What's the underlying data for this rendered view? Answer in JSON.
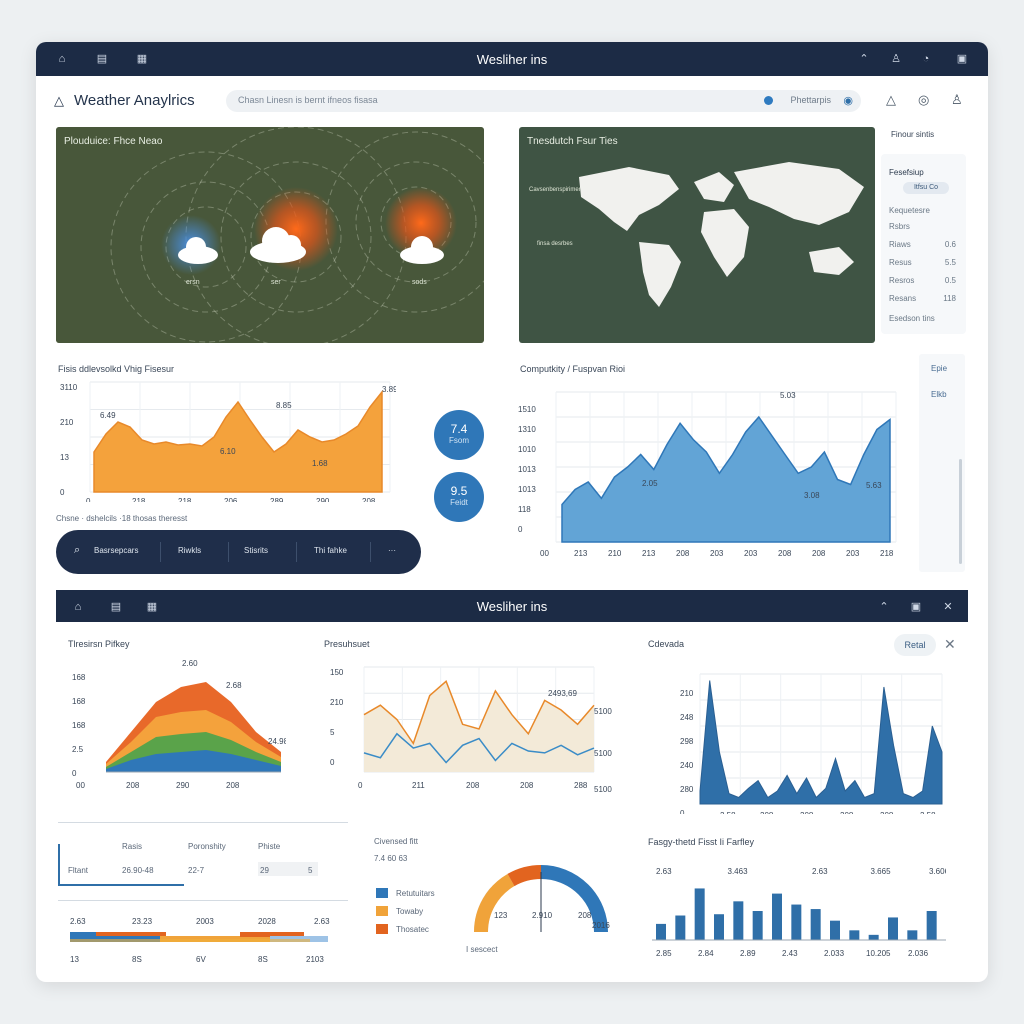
{
  "window": {
    "title": "Wesliher ins",
    "title2": "Wesliher ins"
  },
  "brand": "Weather Anaylrics",
  "search": {
    "placeholder": "Chasn Linesn is bernt ifneos fisasa",
    "location": "Phettarpis"
  },
  "map1": {
    "label": "Plouduice: Fhce Neao",
    "markers": [
      "ersn",
      "ser",
      "sods"
    ]
  },
  "map2": {
    "label": "Tnesdutch Fsur Ties",
    "labels": [
      "Cavsenbenspirimer",
      "finsa desrbes"
    ]
  },
  "side": {
    "title": "Finour sintis",
    "heading": "Fesefsiup",
    "chip": "Itfsu  Co",
    "rows": [
      {
        "k": "Kequetesre",
        "v": ""
      },
      {
        "k": "Rsbrs",
        "v": ""
      },
      {
        "k": "Riaws",
        "v": "0.6"
      },
      {
        "k": "Resus",
        "v": "5.5"
      },
      {
        "k": "Resros",
        "v": "0.5"
      },
      {
        "k": "Resans",
        "v": "118"
      },
      {
        "k": "Esedson tins",
        "v": ""
      }
    ]
  },
  "rpanel": {
    "a": "Epie",
    "b": "Elkb"
  },
  "chart_left": {
    "title": "Fisis ddlevsolkd  Vhig Fisesur",
    "caption": "Chsne · dshelcils  ·18  thosas  theresst"
  },
  "chart_right": {
    "title": "Computkity / Fuspvan Rioi"
  },
  "circles": [
    {
      "n": "7.4",
      "t": "Fsom"
    },
    {
      "n": "9.5",
      "t": "Feidt"
    }
  ],
  "pill": [
    "Basrsepcars",
    "Riwkls",
    "Stisrits",
    "Thi fahke",
    "···"
  ],
  "panel_a": {
    "title": "Tlresirsn Pifkey"
  },
  "panel_b": {
    "title": "Presuhsuet"
  },
  "panel_c": {
    "title": "Cdevada"
  },
  "retail": "Retal",
  "table": {
    "headers": [
      "Rasis",
      "Poronshity",
      "Phiste"
    ],
    "row": [
      "Fltant",
      "26.90-48",
      "22-7",
      "29",
      "5"
    ]
  },
  "gauge": {
    "title": "Civensed fitt",
    "sub": "7.4  60  63",
    "legend": [
      "Retutuitars",
      "Towaby",
      "Thosatec"
    ],
    "ticks": [
      "123",
      "2.910",
      "208",
      "2016"
    ],
    "foot": "I sescect"
  },
  "bars_title": "Fasgy-thetd Fisst  Ii Farfley",
  "chart_data": [
    {
      "type": "area",
      "title": "Fisis ddlevsolkd  Vhig Fisesur",
      "xticks": [
        "0",
        "218",
        "218",
        "206",
        "289",
        "290",
        "208"
      ],
      "yticks": [
        "3110",
        "210",
        "13",
        "0"
      ],
      "labels": [
        "6.49",
        "6.10",
        "8.85",
        "1.68",
        "3.89"
      ],
      "values": [
        40,
        58,
        70,
        65,
        52,
        48,
        50,
        47,
        48,
        46,
        55,
        75,
        90,
        72,
        55,
        40,
        48,
        62,
        55,
        50,
        52,
        58,
        66,
        85,
        100
      ],
      "ylim": [
        0,
        110
      ]
    },
    {
      "type": "area",
      "title": "Computkity / Fuspvan Rioi",
      "xticks": [
        "00",
        "213",
        "210",
        "213",
        "208",
        "203",
        "203",
        "208",
        "208",
        "203",
        "218"
      ],
      "yticks": [
        "1510",
        "1310",
        "1010",
        "1013",
        "1013",
        "118",
        "0"
      ],
      "labels": [
        "5.03",
        "2.05",
        "3.08",
        "5.63"
      ],
      "values": [
        30,
        42,
        48,
        35,
        52,
        60,
        70,
        58,
        78,
        95,
        82,
        72,
        55,
        70,
        88,
        100,
        85,
        70,
        55,
        60,
        72,
        50,
        46,
        70,
        90,
        98
      ],
      "ylim": [
        0,
        120
      ]
    },
    {
      "type": "area",
      "title": "Tlresirsn Pifkey",
      "series": [
        {
          "name": "",
          "values": [
            10,
            40,
            70,
            85,
            90,
            70,
            40,
            20
          ]
        },
        {
          "name": "",
          "values": [
            8,
            30,
            55,
            60,
            62,
            50,
            30,
            15
          ]
        },
        {
          "name": "",
          "values": [
            5,
            20,
            35,
            38,
            40,
            32,
            20,
            10
          ]
        },
        {
          "name": "",
          "values": [
            3,
            12,
            18,
            20,
            22,
            18,
            12,
            6
          ]
        }
      ],
      "labels": [
        "2.60",
        "2.68",
        "24.98"
      ],
      "xticks": [
        "00",
        "208",
        "290",
        "208"
      ],
      "yticks": [
        "168",
        "168",
        "168",
        "2.5",
        "0"
      ],
      "ylim": [
        0,
        100
      ]
    },
    {
      "type": "line",
      "title": "Presuhsuet",
      "series": [
        {
          "name": "",
          "values": [
            60,
            70,
            55,
            30,
            80,
            95,
            50,
            45,
            85,
            60,
            40,
            75,
            65,
            50,
            70
          ]
        },
        {
          "name": "",
          "values": [
            20,
            15,
            40,
            25,
            30,
            10,
            28,
            35,
            12,
            30,
            22,
            20,
            28,
            18,
            25
          ]
        }
      ],
      "labels": [
        "2493,69",
        "5100",
        "5100",
        "5100"
      ],
      "xticks": [
        "0",
        "211",
        "208",
        "208",
        "288"
      ],
      "yticks": [
        "150",
        "210",
        "5",
        "0"
      ],
      "ylim": [
        0,
        110
      ]
    },
    {
      "type": "area",
      "title": "Cdevada",
      "values": [
        10,
        95,
        40,
        8,
        5,
        12,
        18,
        5,
        10,
        22,
        8,
        20,
        5,
        12,
        35,
        10,
        18,
        5,
        8,
        90,
        45,
        8,
        5,
        10,
        60,
        40
      ],
      "xticks": [
        "2.58",
        "208",
        "208",
        "208",
        "208",
        "2.58"
      ],
      "yticks": [
        "210",
        "248",
        "298",
        "240",
        "280",
        "0"
      ],
      "ylim": [
        0,
        100
      ]
    },
    {
      "type": "bar",
      "title": "Fasgy-thetd Fisst  Ii Farfley",
      "values": [
        25,
        38,
        80,
        40,
        60,
        45,
        72,
        55,
        48,
        30,
        15,
        8,
        35,
        15,
        45
      ],
      "labels": [
        "2.63",
        "3.463",
        "2.63",
        "3.665",
        "3.606"
      ],
      "xticks": [
        "2.85",
        "2.84",
        "2.89",
        "2.43",
        "2.033",
        "10.205",
        "2.036"
      ],
      "ylim": [
        0,
        90
      ]
    }
  ]
}
